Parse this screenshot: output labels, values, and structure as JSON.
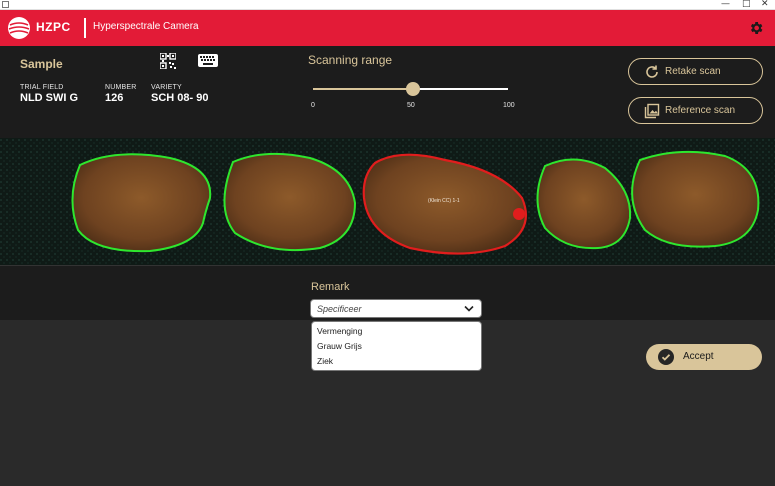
{
  "window": {
    "minimize": "—",
    "maximize": "□",
    "close": "✕"
  },
  "header": {
    "brand": "HZPC",
    "title": "Hyperspectrale Camera",
    "colors": {
      "bar": "#e31b37",
      "text": "#ffffff"
    },
    "icons": {
      "logo": "globe-logo",
      "settings": "gear-icon"
    }
  },
  "sample": {
    "title": "Sample",
    "qr_icon": "qr-code-icon",
    "keyboard_icon": "keyboard-icon",
    "fields": [
      {
        "label": "TRIAL FIELD",
        "value": "NLD SWI G"
      },
      {
        "label": "NUMBER",
        "value": "126"
      },
      {
        "label": "VARIETY",
        "value": "SCH 08- 90"
      }
    ]
  },
  "scanning": {
    "title": "Scanning range",
    "min": "0",
    "mid": "50",
    "max": "100",
    "value": 50
  },
  "actions": {
    "retake": "Retake scan",
    "reference": "Reference scan",
    "retake_icon": "refresh-icon",
    "reference_icon": "image-gallery-icon"
  },
  "scan": {
    "detection_label": "(Klein CC) 1-1",
    "items": [
      {
        "status": "ok",
        "color": "#2ee62e"
      },
      {
        "status": "ok",
        "color": "#2ee62e"
      },
      {
        "status": "flagged",
        "color": "#e11d1d"
      },
      {
        "status": "ok",
        "color": "#2ee62e"
      },
      {
        "status": "ok",
        "color": "#2ee62e"
      }
    ]
  },
  "remark": {
    "title": "Remark",
    "placeholder": "Specificeer",
    "options": [
      "Vermenging",
      "Grauw Grijs",
      "Ziek"
    ]
  },
  "accept": {
    "label": "Accept",
    "icon": "check-circle-icon"
  },
  "theme": {
    "accent": "#d9c59a",
    "panel": "#1c1c1c",
    "background": "#2a2a2a"
  }
}
